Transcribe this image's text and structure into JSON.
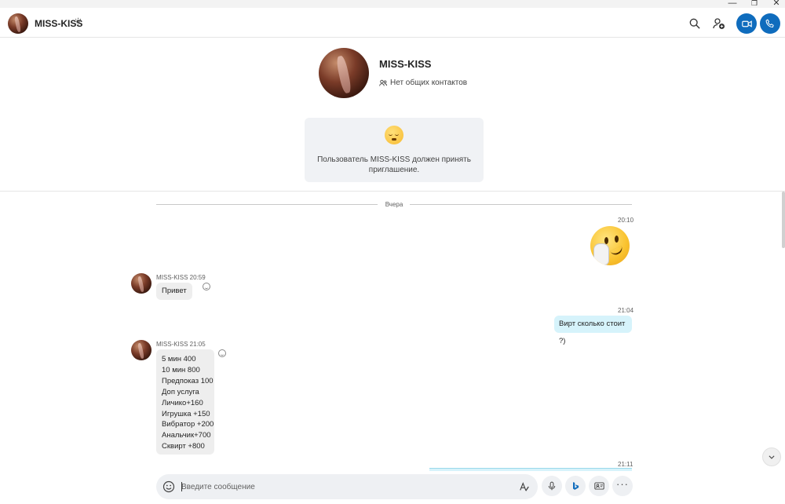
{
  "window": {
    "minimize_glyph": "—",
    "maximize_glyph": "❐",
    "close_glyph": "✕"
  },
  "header": {
    "contact_name": "MISS-KISS",
    "icons": [
      "gear-icon",
      "search-icon",
      "add-contact-icon",
      "video-call-icon",
      "audio-call-icon"
    ],
    "accent_color": "#0f6cbd"
  },
  "profile": {
    "name": "MISS-KISS",
    "contacts_text": "Нет общих контактов"
  },
  "invite": {
    "text": "Пользователь MISS-KISS должен принять приглашение."
  },
  "chat": {
    "date_divider": "Вчера",
    "messages": [
      {
        "direction": "out",
        "time": "20:10",
        "type": "emoji",
        "emoji": "face-with-hand-over-mouth"
      },
      {
        "direction": "in",
        "sender": "MISS-KISS",
        "time": "20:59",
        "meta": "MISS-KISS 20:59",
        "text": "Привет"
      },
      {
        "direction": "out",
        "time": "21:04",
        "text": "Вирт сколько стоит ?)"
      },
      {
        "direction": "in",
        "sender": "MISS-KISS",
        "time": "21:05",
        "meta": "MISS-KISS 21:05",
        "lines": [
          "5 мин 400",
          "10 мин 800",
          "Предпоказ 100",
          "Доп услуга",
          "Личико+160",
          "Игрушка +150",
          "Вибратор +200",
          "Анальчик+700",
          "Сквирт +800"
        ]
      },
      {
        "direction": "out",
        "time": "21:11",
        "text": ""
      }
    ]
  },
  "composer": {
    "placeholder": "Введите сообщение",
    "value": ""
  }
}
